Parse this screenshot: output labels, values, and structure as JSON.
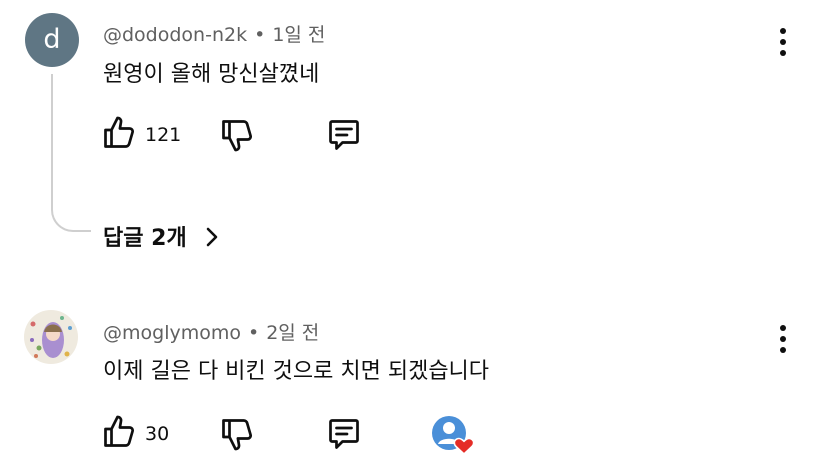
{
  "comments": [
    {
      "author": "@dododon-n2k",
      "avatar_letter": "d",
      "time": "1일 전",
      "text": "원영이 올해 망신살꼈네",
      "likes": "121",
      "replies_label": "답글 2개"
    },
    {
      "author": "@moglymomo",
      "time": "2일 전",
      "text": "이제 길은 다 비킨 것으로 치면 되겠습니다",
      "likes": "30"
    }
  ],
  "separator": "•",
  "icons": [
    "like-icon",
    "dislike-icon",
    "reply-icon",
    "more-options-icon",
    "chevron-right-icon",
    "creator-heart-icon"
  ],
  "colors": {
    "avatar_bg": "#5f7684",
    "meta_text": "#606060",
    "heart": "#e52d27"
  }
}
